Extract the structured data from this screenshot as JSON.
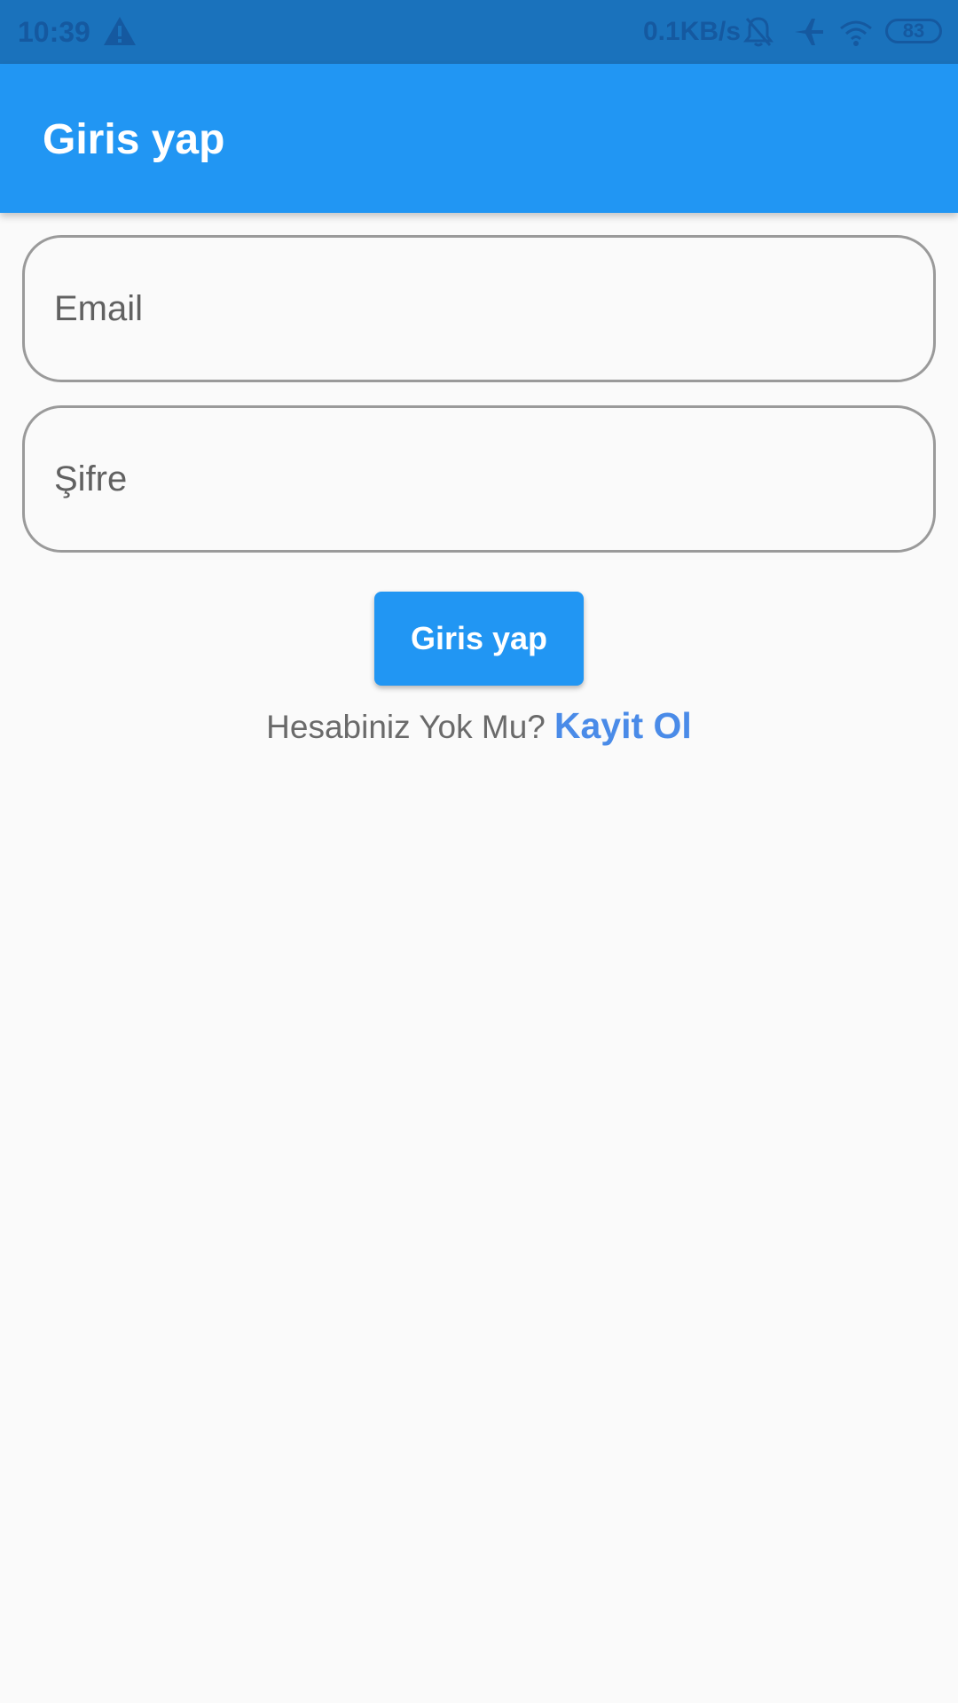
{
  "status_bar": {
    "time": "10:39",
    "network_speed": "0.1KB/s",
    "battery_level": "83",
    "icons": [
      "warning-icon",
      "bell-off-icon",
      "airplane-icon",
      "wifi-icon",
      "battery-icon"
    ],
    "color": "#1559a0",
    "background": "#1a72bc"
  },
  "app_bar": {
    "title": "Giris yap",
    "background": "#2196f3"
  },
  "form": {
    "email": {
      "placeholder": "Email",
      "value": ""
    },
    "password": {
      "placeholder": "Şifre",
      "value": ""
    },
    "submit_label": "Giris yap"
  },
  "register": {
    "question": "Hesabiniz Yok Mu?",
    "link_label": "Kayit Ol",
    "link_color": "#4a8be8"
  },
  "colors": {
    "primary": "#2196f3",
    "background": "#fafafa",
    "field_border": "#9a9a9a"
  }
}
